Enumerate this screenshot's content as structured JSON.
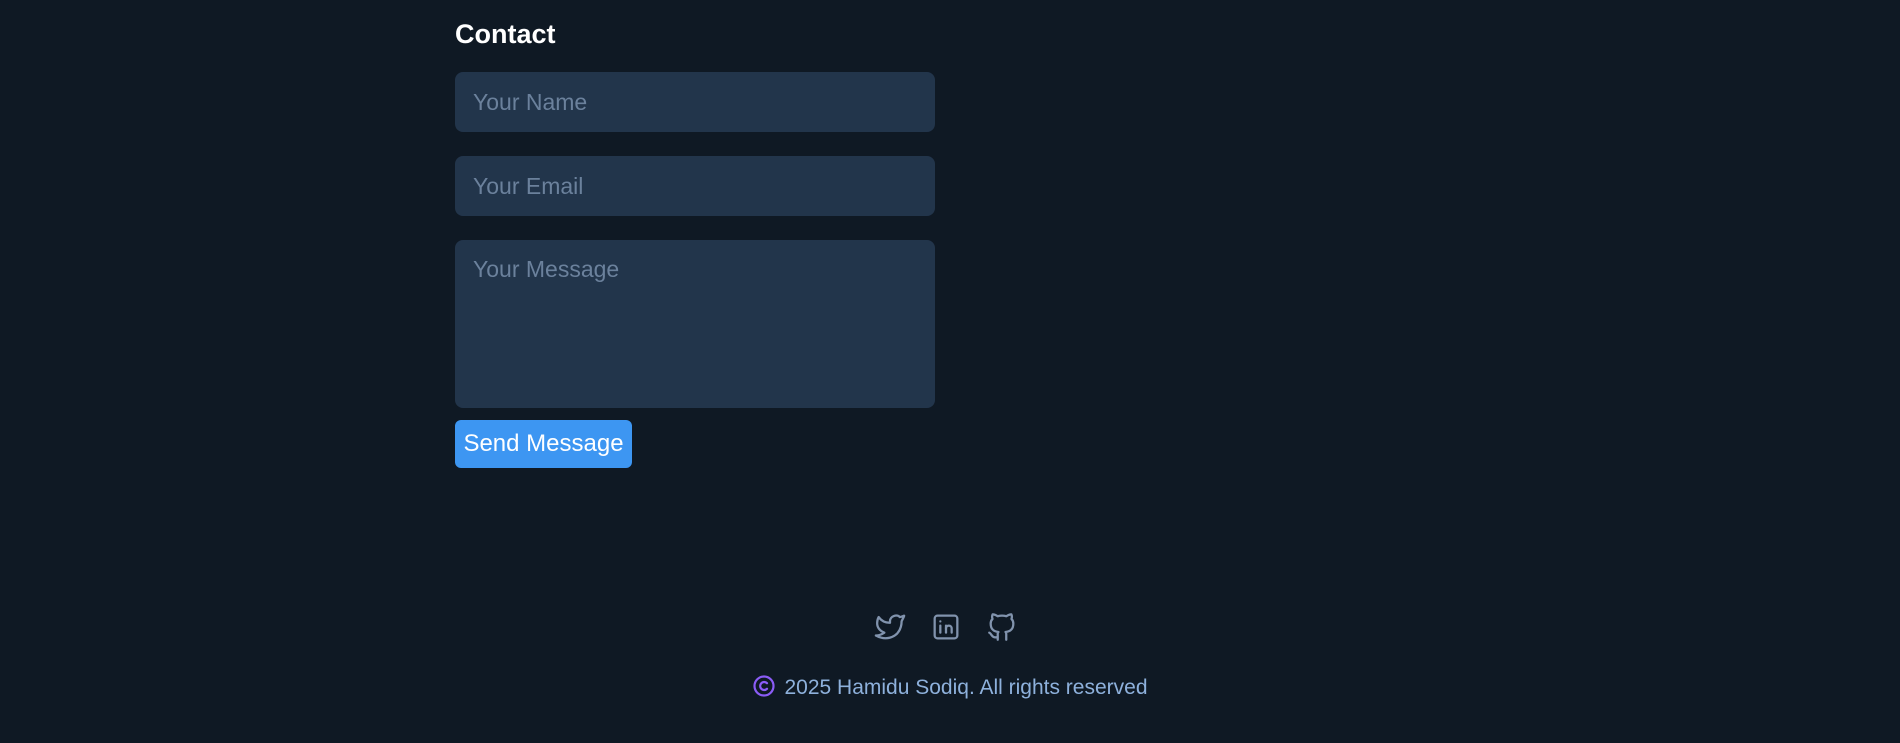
{
  "contact": {
    "title": "Contact",
    "name_placeholder": "Your Name",
    "email_placeholder": "Your Email",
    "message_placeholder": "Your Message",
    "send_label": "Send Message"
  },
  "footer": {
    "social_icons": [
      "twitter-icon",
      "linkedin-icon",
      "github-icon"
    ],
    "copyright_text": "2025 Hamidu Sodiq. All rights reserved"
  },
  "colors": {
    "background": "#0f1924",
    "field_background": "#22354b",
    "accent_button": "#3d96f2",
    "icon": "#8193ad",
    "copyright_icon": "#8b5cf6",
    "footer_text": "#8eb1dc"
  }
}
